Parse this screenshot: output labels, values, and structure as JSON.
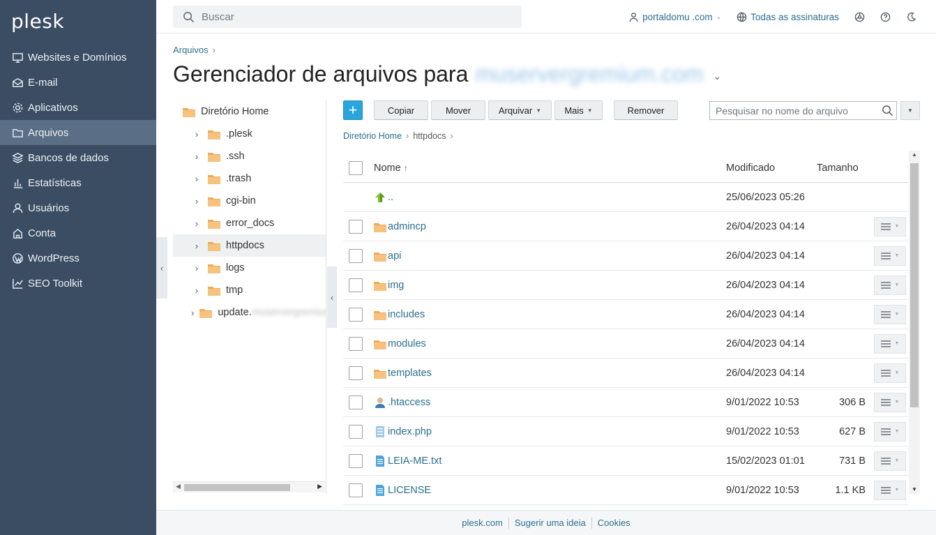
{
  "brand": {
    "logo": "plesk"
  },
  "sidebar": {
    "items": [
      {
        "label": "Websites e Domínios",
        "icon": "monitor-icon"
      },
      {
        "label": "E-mail",
        "icon": "envelope-icon"
      },
      {
        "label": "Aplicativos",
        "icon": "gear-icon"
      },
      {
        "label": "Arquivos",
        "icon": "folder-icon",
        "active": true
      },
      {
        "label": "Bancos de dados",
        "icon": "database-icon"
      },
      {
        "label": "Estatísticas",
        "icon": "bar-chart-icon"
      },
      {
        "label": "Usuários",
        "icon": "user-icon"
      },
      {
        "label": "Conta",
        "icon": "account-icon"
      },
      {
        "label": "WordPress",
        "icon": "wordpress-icon"
      },
      {
        "label": "SEO Toolkit",
        "icon": "seo-chart-icon"
      }
    ]
  },
  "header": {
    "search_placeholder": "Buscar",
    "user": "portaldomu .com",
    "subscriptions": "Todas as assinaturas"
  },
  "breadcrumb": {
    "root": "Arquivos"
  },
  "page": {
    "title": "Gerenciador de arquivos para",
    "domain_blurred": "muservergremium.com"
  },
  "tree": {
    "root": "Diretório Home",
    "items": [
      {
        "label": ".plesk"
      },
      {
        "label": ".ssh"
      },
      {
        "label": ".trash"
      },
      {
        "label": "cgi-bin"
      },
      {
        "label": "error_docs"
      },
      {
        "label": "httpdocs",
        "selected": true
      },
      {
        "label": "logs"
      },
      {
        "label": "tmp"
      },
      {
        "label": "update.",
        "blurred": "muservergremium"
      }
    ]
  },
  "toolbar": {
    "add": "+",
    "copy": "Copiar",
    "move": "Mover",
    "archive": "Arquivar",
    "more": "Mais",
    "remove": "Remover",
    "file_search_placeholder": "Pesquisar no nome do arquivo"
  },
  "path": {
    "home": "Diretório Home",
    "current": "httpdocs"
  },
  "table": {
    "headers": {
      "name": "Nome",
      "sort_arrow": "↑",
      "modified": "Modificado",
      "size": "Tamanho"
    },
    "rows": [
      {
        "name": "..",
        "modified": "25/06/2023 05:26",
        "size": "",
        "type": "up"
      },
      {
        "name": "admincp",
        "modified": "26/04/2023 04:14",
        "size": "",
        "type": "folder"
      },
      {
        "name": "api",
        "modified": "26/04/2023 04:14",
        "size": "",
        "type": "folder"
      },
      {
        "name": "img",
        "modified": "26/04/2023 04:14",
        "size": "",
        "type": "folder"
      },
      {
        "name": "includes",
        "modified": "26/04/2023 04:14",
        "size": "",
        "type": "folder"
      },
      {
        "name": "modules",
        "modified": "26/04/2023 04:14",
        "size": "",
        "type": "folder"
      },
      {
        "name": "templates",
        "modified": "26/04/2023 04:14",
        "size": "",
        "type": "folder"
      },
      {
        "name": ".htaccess",
        "modified": "9/01/2022 10:53",
        "size": "306 B",
        "type": "htaccess"
      },
      {
        "name": "index.php",
        "modified": "9/01/2022 10:53",
        "size": "627 B",
        "type": "php"
      },
      {
        "name": "LEIA-ME.txt",
        "modified": "15/02/2023 01:01",
        "size": "731 B",
        "type": "text"
      },
      {
        "name": "LICENSE",
        "modified": "9/01/2022 10:53",
        "size": "1.1 KB",
        "type": "text"
      }
    ]
  },
  "footer": {
    "links": [
      "plesk.com",
      "Sugerir uma ideia",
      "Cookies"
    ]
  },
  "colors": {
    "sidebar": "#3b4d63",
    "sidebar_active": "#5a6e86",
    "link": "#2c6e8f",
    "folder": "#f0a95a",
    "add_button": "#29a4dd"
  }
}
